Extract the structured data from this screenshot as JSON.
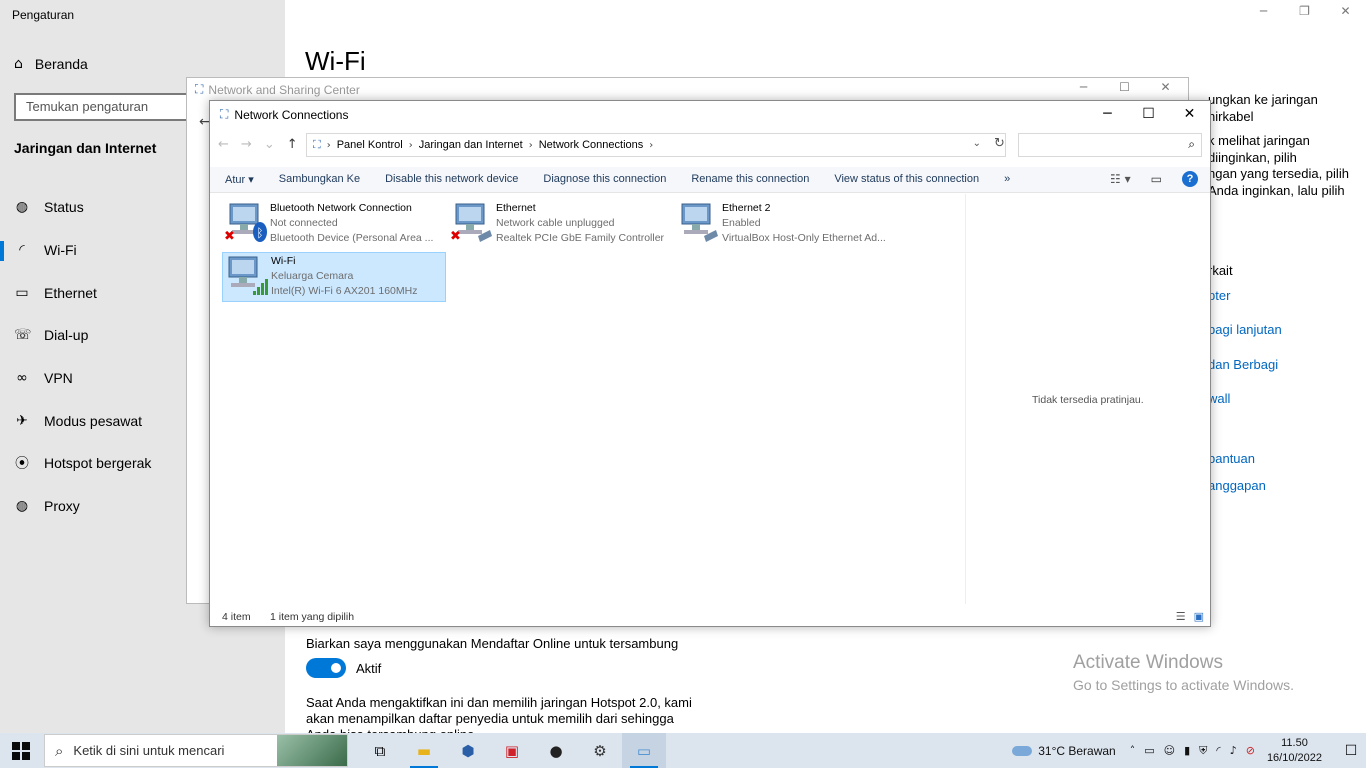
{
  "settings": {
    "app_title": "Pengaturan",
    "home_label": "Beranda",
    "search_placeholder": "Temukan pengaturan",
    "section_title": "Jaringan dan Internet",
    "nav_items": [
      {
        "label": "Status",
        "icon": "globe-icon"
      },
      {
        "label": "Wi-Fi",
        "icon": "wifi-icon"
      },
      {
        "label": "Ethernet",
        "icon": "ethernet-icon"
      },
      {
        "label": "Dial-up",
        "icon": "dialup-icon"
      },
      {
        "label": "VPN",
        "icon": "vpn-icon"
      },
      {
        "label": "Modus pesawat",
        "icon": "airplane-icon"
      },
      {
        "label": "Hotspot bergerak",
        "icon": "hotspot-icon"
      },
      {
        "label": "Proxy",
        "icon": "globe-icon"
      }
    ],
    "page_title": "Wi-Fi",
    "right_panel": {
      "line1": "ungkan ke jaringan nirkabel",
      "line2": "k melihat jaringan",
      "line3": "diinginkan, pilih",
      "line4": "ngan yang tersedia, pilih",
      "line5": "Anda inginkan, lalu pilih",
      "related_heading": "rkait",
      "link1": "pter",
      "link2": "bagi lanjutan",
      "link3": " dan Berbagi",
      "link4": "wall",
      "link5": " bantuan",
      "link6": "anggapan"
    },
    "online_signup_text": "Biarkan saya menggunakan Mendaftar Online untuk tersambung",
    "toggle_label": "Aktif",
    "hotspot_desc": "Saat Anda mengaktifkan ini dan memilih jaringan Hotspot 2.0, kami akan menampilkan daftar penyedia untuk memilih dari sehingga Anda bisa tersambung online."
  },
  "activate": {
    "title": "Activate Windows",
    "subtitle": "Go to Settings to activate Windows."
  },
  "nsc": {
    "title": "Network and Sharing Center"
  },
  "nc": {
    "title": "Network Connections",
    "address": [
      "Panel Kontrol",
      "Jaringan dan Internet",
      "Network Connections"
    ],
    "toolbar": [
      "Atur ▾",
      "Sambungkan Ke",
      "Disable this network device",
      "Diagnose this connection",
      "Rename this connection",
      "View status of this connection",
      "»"
    ],
    "connections": [
      {
        "name": "Bluetooth Network Connection",
        "status": "Not connected",
        "device": "Bluetooth Device (Personal Area ...",
        "selected": false
      },
      {
        "name": "Ethernet",
        "status": "Network cable unplugged",
        "device": "Realtek PCIe GbE Family Controller",
        "selected": false
      },
      {
        "name": "Ethernet 2",
        "status": "Enabled",
        "device": "VirtualBox Host-Only Ethernet Ad...",
        "selected": false
      },
      {
        "name": "Wi-Fi",
        "status": "Keluarga Cemara",
        "device": "Intel(R) Wi-Fi 6 AX201 160MHz",
        "selected": true
      }
    ],
    "preview_text": "Tidak tersedia pratinjau.",
    "status_count": "4 item",
    "status_selected": "1 item yang dipilih"
  },
  "taskbar": {
    "search_placeholder": "Ketik di sini untuk mencari",
    "weather": "31°C  Berawan",
    "time": "11.50",
    "date": "16/10/2022"
  },
  "colors": {
    "accent": "#0078d7",
    "selection": "#cce8ff",
    "link": "#0067c0"
  }
}
